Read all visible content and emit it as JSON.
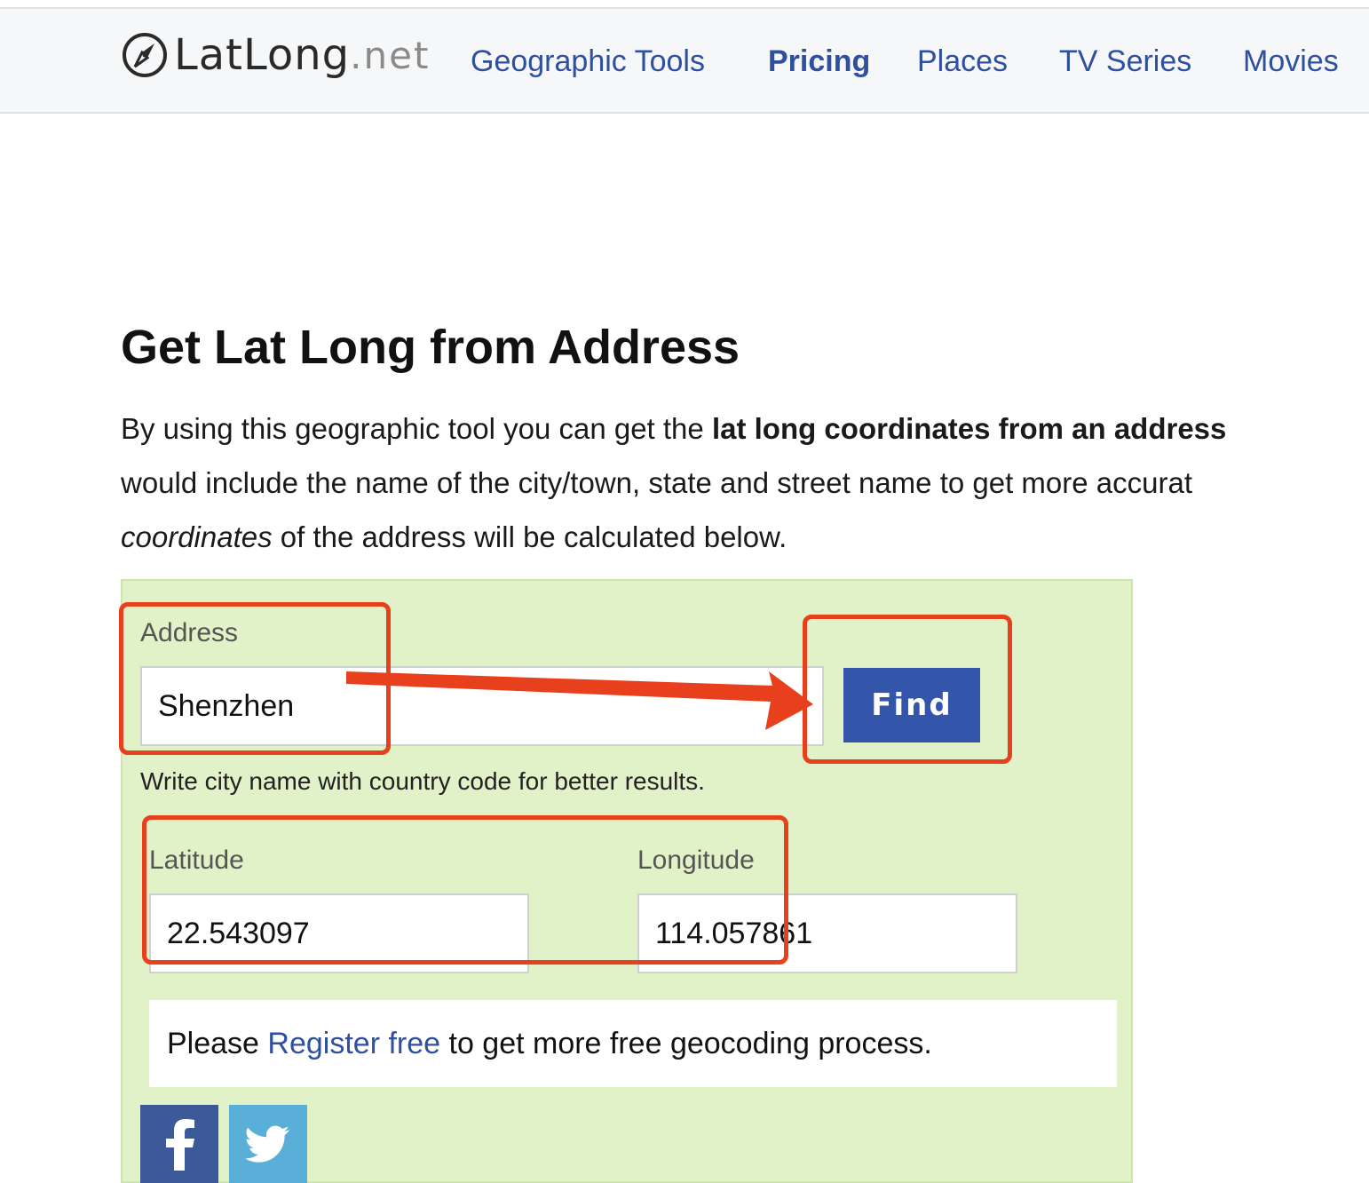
{
  "logo": {
    "name": "LatLong",
    "tld": ".net"
  },
  "nav": {
    "items": [
      {
        "label": "Geographic Tools"
      },
      {
        "label": "Pricing"
      },
      {
        "label": "Places"
      },
      {
        "label": "TV Series"
      },
      {
        "label": "Movies"
      }
    ]
  },
  "main": {
    "title": "Get Lat Long from Address",
    "intro": {
      "line1_prefix": "By using this geographic tool you can get the ",
      "line1_bold": "lat long coordinates from an address",
      "line2": "would include the name of the city/town, state and street name to get more accurat",
      "line3_italic": "coordinates",
      "line3_rest": " of the address will be calculated below."
    }
  },
  "tool": {
    "address_label": "Address",
    "address_value": "Shenzhen",
    "find_label": "Find",
    "hint": "Write city name with country code for better results.",
    "latitude_label": "Latitude",
    "latitude_value": "22.543097",
    "longitude_label": "Longitude",
    "longitude_value": "114.057861",
    "register_prefix": "Please ",
    "register_link": "Register free",
    "register_suffix": " to get more free geocoding process."
  },
  "social": {
    "facebook": "facebook-icon",
    "twitter": "twitter-icon"
  },
  "colors": {
    "nav_link": "#2f4f9f",
    "find_button": "#3355aa",
    "panel_bg": "#e2f2c8",
    "annotation": "#e8401c"
  }
}
